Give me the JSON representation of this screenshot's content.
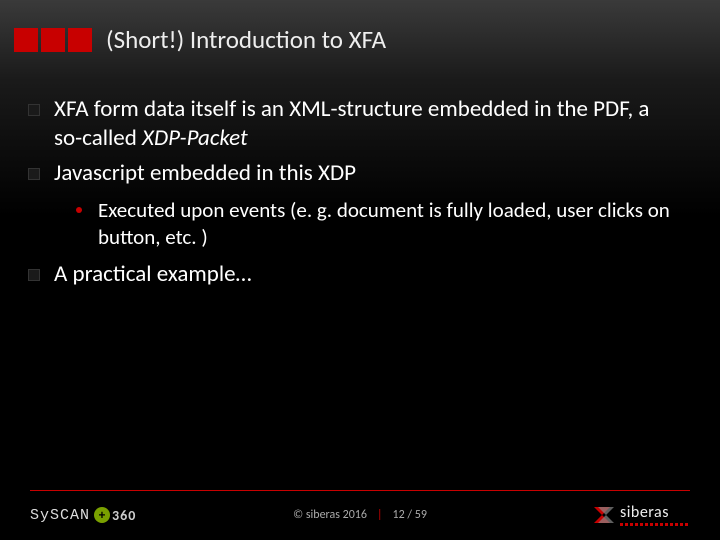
{
  "title": "(Short!) Introduction to XFA",
  "bullets": {
    "b1_pre": "XFA form data itself is an XML-structure embedded in the PDF, a so-called ",
    "b1_em": "XDP-Packet",
    "b2": "Javascript embedded in this XDP",
    "b2_sub1": "Executed upon events (e. g. document is fully loaded, user clicks on button, etc. )",
    "b3": "A practical example…"
  },
  "footer": {
    "left_syscan": "SySCAN",
    "left_360": "360",
    "copyright": "© siberas 2016",
    "sep": "|",
    "page": "12 / 59",
    "right_brand": "siberas"
  }
}
